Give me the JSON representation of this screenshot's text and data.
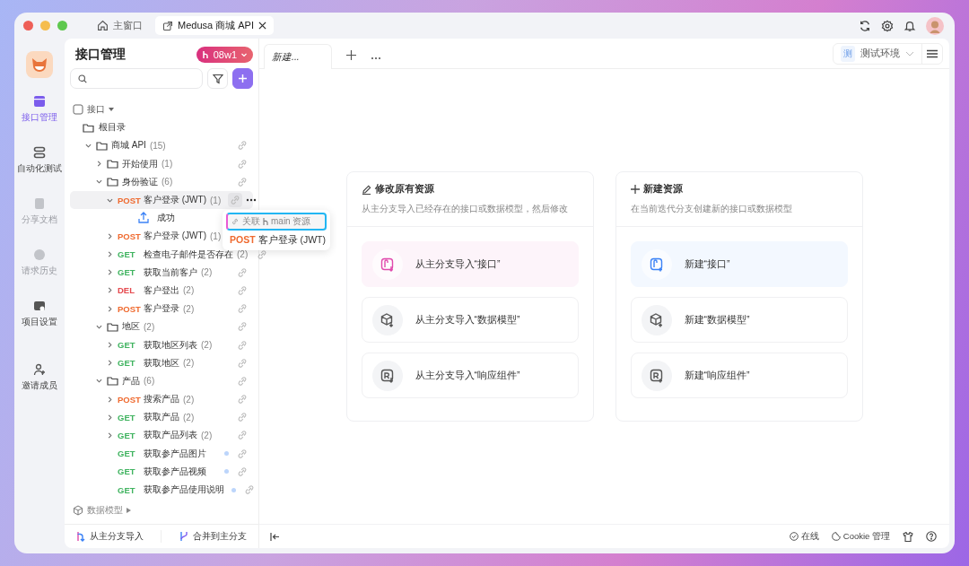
{
  "title_tabs": [
    {
      "kind": "home",
      "label": "主窗口",
      "selected": false
    },
    {
      "kind": "project",
      "label": "Medusa 商城 API",
      "selected": true
    }
  ],
  "nav": [
    {
      "label": "接口管理",
      "selected": true,
      "disabled": false
    },
    {
      "label": "自动化测试",
      "selected": false,
      "disabled": false
    },
    {
      "label": "分享文档",
      "selected": false,
      "disabled": true
    },
    {
      "label": "请求历史",
      "selected": false,
      "disabled": true
    },
    {
      "label": "项目设置",
      "selected": false,
      "disabled": false
    },
    {
      "label": "邀请成员",
      "selected": false,
      "disabled": false
    }
  ],
  "sidebar": {
    "title": "接口管理",
    "branch": "08w1",
    "section_label": "接口",
    "root_folder": "根目录",
    "tree": [
      {
        "kind": "folder",
        "label": "商城 API",
        "count": "(15)",
        "expanded": true,
        "selected": false,
        "children": [
          {
            "kind": "folder",
            "label": "开始使用",
            "count": "(1)",
            "expanded": false,
            "selected": false
          },
          {
            "kind": "folder",
            "label": "身份验证",
            "count": "(6)",
            "expanded": true,
            "selected": false,
            "children": [
              {
                "kind": "api",
                "method": "POST",
                "label": "客户登录 (JWT)",
                "count": "(1)",
                "expanded": true,
                "selected": true,
                "children": [
                  {
                    "kind": "response",
                    "label": "成功",
                    "selected": false
                  }
                ]
              },
              {
                "kind": "api",
                "method": "POST",
                "label": "客户登录 (JWT)",
                "count": "(1)",
                "expanded": false,
                "selected": false
              },
              {
                "kind": "api",
                "method": "GET",
                "label": "检查电子邮件是否存在",
                "count": "(2)",
                "expanded": false,
                "selected": false
              },
              {
                "kind": "api",
                "method": "GET",
                "label": "获取当前客户",
                "count": "(2)",
                "expanded": false,
                "selected": false
              },
              {
                "kind": "api",
                "method": "DEL",
                "label": "客户登出",
                "count": "(2)",
                "expanded": false,
                "selected": false
              },
              {
                "kind": "api",
                "method": "POST",
                "label": "客户登录",
                "count": "(2)",
                "expanded": false,
                "selected": false
              }
            ]
          },
          {
            "kind": "folder",
            "label": "地区",
            "count": "(2)",
            "expanded": true,
            "selected": false,
            "children": [
              {
                "kind": "api",
                "method": "GET",
                "label": "获取地区列表",
                "count": "(2)",
                "expanded": false,
                "selected": false
              },
              {
                "kind": "api",
                "method": "GET",
                "label": "获取地区",
                "count": "(2)",
                "expanded": false,
                "selected": false
              }
            ]
          },
          {
            "kind": "folder",
            "label": "产品",
            "count": "(6)",
            "expanded": true,
            "selected": false,
            "children": [
              {
                "kind": "api",
                "method": "POST",
                "label": "搜索产品",
                "count": "(2)",
                "expanded": false,
                "selected": false
              },
              {
                "kind": "api",
                "method": "GET",
                "label": "获取产品",
                "count": "(2)",
                "expanded": false,
                "selected": false
              },
              {
                "kind": "api",
                "method": "GET",
                "label": "获取产品列表",
                "count": "(2)",
                "expanded": false,
                "selected": false
              },
              {
                "kind": "api",
                "method": "GET",
                "label": "获取参产品图片",
                "selected": false,
                "modified": true
              },
              {
                "kind": "api",
                "method": "GET",
                "label": "获取参产品视频",
                "selected": false,
                "modified": true
              },
              {
                "kind": "api",
                "method": "GET",
                "label": "获取参产品使用说明",
                "selected": false,
                "modified": true
              }
            ]
          }
        ]
      }
    ],
    "models_label": "数据模型",
    "footer_buttons": [
      "从主分支导入",
      "合并到主分支"
    ]
  },
  "popover": {
    "link_label": "关联",
    "link_branch": "main 资源",
    "item_method": "POST",
    "item_label": "客户登录 (JWT)"
  },
  "main": {
    "tabs": [
      {
        "label": "新建...",
        "selected": true
      }
    ],
    "environment": {
      "badge": "测",
      "label": "测试环境"
    },
    "cards": [
      {
        "kind": "modify",
        "title": "修改原有资源",
        "description": "从主分支导入已经存在的接口或数据模型，然后修改",
        "options": [
          {
            "label": "从主分支导入“接口”",
            "highlighted": true
          },
          {
            "label": "从主分支导入“数据模型”",
            "highlighted": false
          },
          {
            "label": "从主分支导入“响应组件”",
            "highlighted": false
          }
        ]
      },
      {
        "kind": "new",
        "title": "新建资源",
        "description": "在当前迭代分支创建新的接口或数据模型",
        "options": [
          {
            "label": "新建“接口”",
            "highlighted": true
          },
          {
            "label": "新建“数据模型”",
            "highlighted": false
          },
          {
            "label": "新建“响应组件”",
            "highlighted": false
          }
        ]
      }
    ]
  },
  "status_bar": {
    "online": "在线",
    "cookie": "Cookie 管理"
  }
}
